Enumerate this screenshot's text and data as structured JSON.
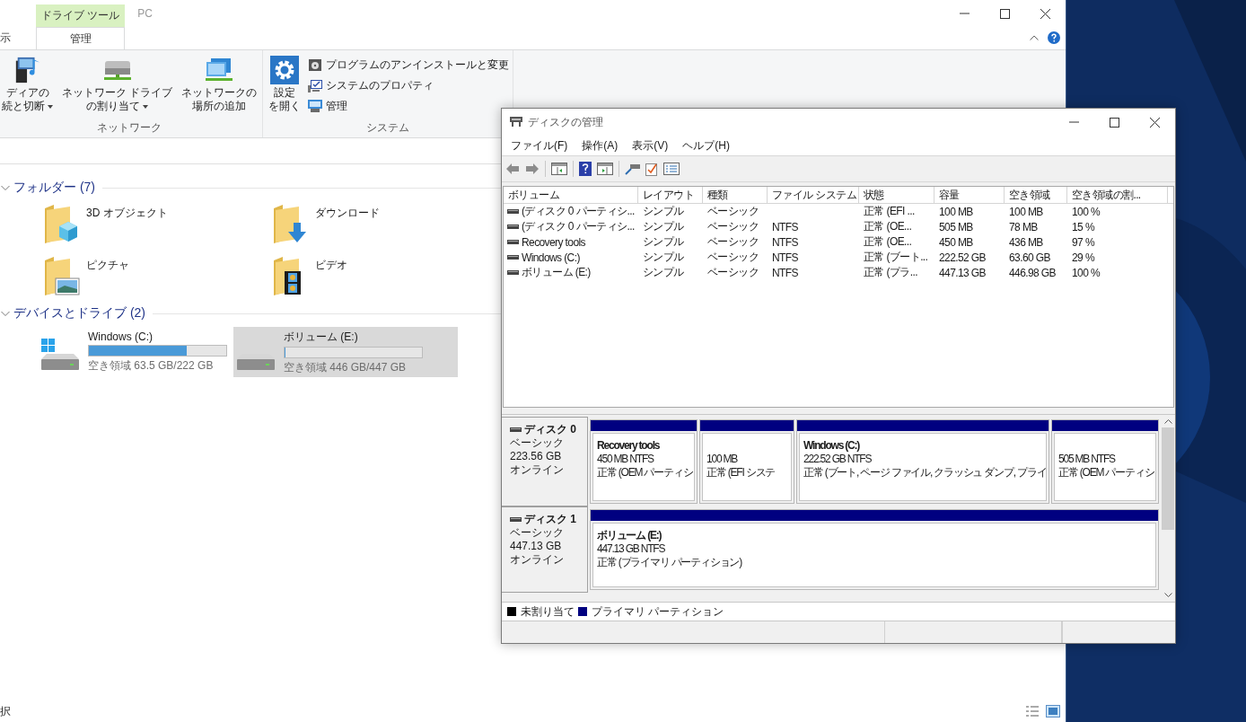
{
  "explorer": {
    "title": "PC",
    "tabs": [
      {
        "label": "示",
        "selected": false
      },
      {
        "label": "管理",
        "selected": true,
        "context": "ドライブ ツール"
      }
    ],
    "ribbon_groups": [
      {
        "label": "ネットワーク",
        "buttons": [
          {
            "lines": [
              "ディアの",
              "続と切断"
            ],
            "dropdown": true
          },
          {
            "lines": [
              "ネットワーク ドライブ",
              "の割り当て"
            ],
            "dropdown": true
          },
          {
            "lines": [
              "ネットワークの",
              "場所の追加"
            ],
            "dropdown": false
          }
        ]
      },
      {
        "label": "システム",
        "buttons": [
          {
            "lines": [
              "設定",
              "を開く"
            ],
            "dropdown": false
          }
        ],
        "small_buttons": [
          {
            "label": "プログラムのアンインストールと変更"
          },
          {
            "label": "システムのプロパティ"
          },
          {
            "label": "管理"
          }
        ]
      }
    ],
    "sections": [
      {
        "title": "フォルダー (7)",
        "expanded": true,
        "kind": "folders",
        "items": [
          {
            "name": "3D オブジェクト"
          },
          {
            "name": "ダウンロード"
          },
          {
            "name": "ピクチャ"
          },
          {
            "name": "ビデオ"
          }
        ]
      },
      {
        "title": "デバイスとドライブ (2)",
        "expanded": true,
        "kind": "drives",
        "items": [
          {
            "name": "Windows (C:)",
            "free": "空き領域 63.5 GB/222 GB",
            "level": 0.714,
            "system": true,
            "selected": false
          },
          {
            "name": "ボリューム (E:)",
            "free": "空き領域 446 GB/447 GB",
            "level": 0.002,
            "system": false,
            "selected": true
          }
        ]
      }
    ],
    "status_text": "択"
  },
  "disk_management": {
    "title": "ディスクの管理",
    "menu": [
      "ファイル(F)",
      "操作(A)",
      "表示(V)",
      "ヘルプ(H)"
    ],
    "table": {
      "columns": [
        "ボリューム",
        "レイアウト",
        "種類",
        "ファイル システム",
        "状態",
        "容量",
        "空き領域",
        "空き領域の割..."
      ],
      "rows": [
        [
          "(ディスク 0 パーティシ...",
          "シンプル",
          "ベーシック",
          "",
          "正常 (EFI ...",
          "100 MB",
          "100 MB",
          "100 %"
        ],
        [
          "(ディスク 0 パーティシ...",
          "シンプル",
          "ベーシック",
          "NTFS",
          "正常 (OE...",
          "505 MB",
          "78 MB",
          "15 %"
        ],
        [
          "Recovery tools",
          "シンプル",
          "ベーシック",
          "NTFS",
          "正常 (OE...",
          "450 MB",
          "436 MB",
          "97 %"
        ],
        [
          "Windows (C:)",
          "シンプル",
          "ベーシック",
          "NTFS",
          "正常 (ブート...",
          "222.52 GB",
          "63.60 GB",
          "29 %"
        ],
        [
          "ボリューム (E:)",
          "シンプル",
          "ベーシック",
          "NTFS",
          "正常 (プラ...",
          "447.13 GB",
          "446.98 GB",
          "100 %"
        ]
      ]
    },
    "disks": [
      {
        "name": "ディスク 0",
        "type": "ベーシック",
        "size": "223.56 GB",
        "status": "オンライン",
        "partitions": [
          {
            "name": "Recovery tools",
            "size": "450 MB NTFS",
            "status": "正常 (OEM パーティシ"
          },
          {
            "size": "100 MB",
            "status": "正常 (EFI システ"
          },
          {
            "name": "Windows  (C:)",
            "size": "222.52 GB NTFS",
            "status": "正常 (ブート, ページ ファイル, クラッシュ ダンプ, プライ"
          },
          {
            "size": "505 MB NTFS",
            "status": "正常 (OEM パーティシ"
          }
        ]
      },
      {
        "name": "ディスク 1",
        "type": "ベーシック",
        "size": "447.13 GB",
        "status": "オンライン",
        "partitions": [
          {
            "name": "ボリューム  (E:)",
            "size": "447.13 GB NTFS",
            "status": "正常 (プライマリ パーティション)"
          }
        ]
      }
    ],
    "legend": [
      {
        "label": "未割り当て",
        "color": "#000000"
      },
      {
        "label": "プライマリ パーティション",
        "color": "#000080"
      }
    ]
  }
}
